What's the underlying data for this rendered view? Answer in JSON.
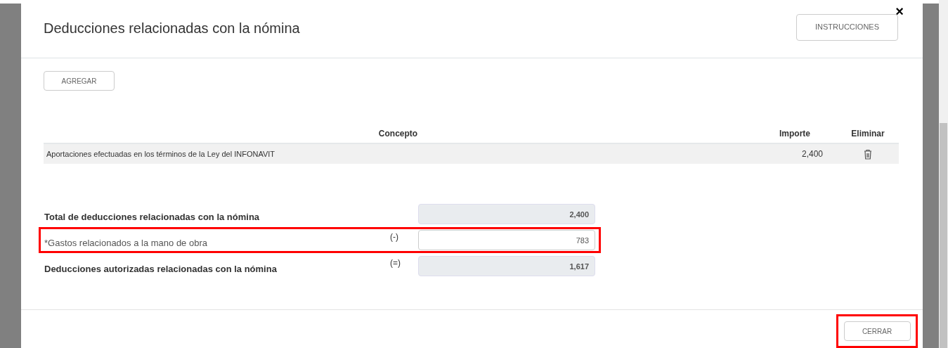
{
  "dialog": {
    "title": "Deducciones relacionadas con la nómina",
    "close": "×",
    "instructions_button": "INSTRUCCIONES"
  },
  "add_button": "AGREGAR",
  "table": {
    "columns": [
      "Concepto",
      "Importe",
      "Eliminar"
    ],
    "rows": [
      {
        "concepto": "Aportaciones efectuadas en los términos de la Ley del INFONAVIT",
        "importe": "2,400"
      }
    ]
  },
  "summary": [
    {
      "label": "Total de deducciones relacionadas con la nómina",
      "kind": "readonly",
      "value": "2,400",
      "highlighted": false
    },
    {
      "label": "*Gastos relacionados a la mano de obra",
      "operator": "(-)",
      "kind": "input",
      "value": "783",
      "highlighted": true
    },
    {
      "label": "Deducciones autorizadas relacionadas con la nómina",
      "operator": "(=)",
      "kind": "readonly",
      "value": "1,617",
      "highlighted": false
    }
  ],
  "footer": {
    "close_button": "CERRAR",
    "highlighted": true
  }
}
